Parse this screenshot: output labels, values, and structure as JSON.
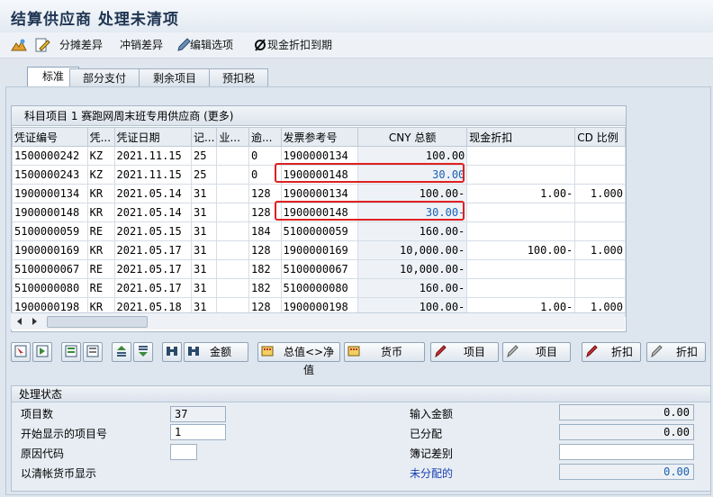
{
  "window": {
    "title": "结算供应商 处理未清项"
  },
  "toolbar": {
    "items": [
      {
        "label": "分摊差异"
      },
      {
        "label": "冲销差异"
      },
      {
        "label": "编辑选项"
      },
      {
        "label": "现金折扣到期"
      }
    ]
  },
  "tabs": [
    {
      "label": "标准"
    },
    {
      "label": "部分支付"
    },
    {
      "label": "剩余项目"
    },
    {
      "label": "预扣税"
    }
  ],
  "table": {
    "title": "科目项目 1 赛跑网周末班专用供应商 (更多)",
    "columns": [
      "凭证编号",
      "凭...",
      "凭证日期",
      "记...",
      "业...",
      "逾...",
      "发票参考号",
      "CNY 总额",
      "现金折扣",
      "CD 比例"
    ],
    "rows": [
      [
        "1500000242",
        "KZ",
        "2021.11.15",
        "25",
        "",
        "0",
        "1900000134",
        "100.00",
        "",
        ""
      ],
      [
        "1500000243",
        "KZ",
        "2021.11.15",
        "25",
        "",
        "0",
        "1900000148",
        "30.00",
        "",
        ""
      ],
      [
        "1900000134",
        "KR",
        "2021.05.14",
        "31",
        "",
        "128",
        "1900000134",
        "100.00-",
        "1.00-",
        "1.000"
      ],
      [
        "1900000148",
        "KR",
        "2021.05.14",
        "31",
        "",
        "128",
        "1900000148",
        "30.00-",
        "",
        ""
      ],
      [
        "5100000059",
        "RE",
        "2021.05.15",
        "31",
        "",
        "184",
        "5100000059",
        "160.00-",
        "",
        ""
      ],
      [
        "1900000169",
        "KR",
        "2021.05.17",
        "31",
        "",
        "128",
        "1900000169",
        "10,000.00-",
        "100.00-",
        "1.000"
      ],
      [
        "5100000067",
        "RE",
        "2021.05.17",
        "31",
        "",
        "182",
        "5100000067",
        "10,000.00-",
        "",
        ""
      ],
      [
        "5100000080",
        "RE",
        "2021.05.17",
        "31",
        "",
        "182",
        "5100000080",
        "160.00-",
        "",
        ""
      ],
      [
        "1900000198",
        "KR",
        "2021.05.18",
        "31",
        "",
        "128",
        "1900000198",
        "100.00-",
        "1.00-",
        "1.000"
      ]
    ],
    "highlight_color": "#e02020",
    "amount_blue": "#1a5fb4"
  },
  "buttons": {
    "amount": "金额",
    "gross_net": "总值<>净值",
    "currency": "货币",
    "item1": "项目",
    "item2": "项目",
    "discount1": "折扣",
    "discount2": "折扣"
  },
  "status": {
    "title": "处理状态",
    "item_count_label": "项目数",
    "item_count": "37",
    "first_item_label": "开始显示的项目号",
    "first_item": "1",
    "reason_label": "原因代码",
    "reason": "",
    "clearing_currency_label": "以清帐货币显示",
    "entered_amount_label": "输入金额",
    "entered_amount": "0.00",
    "assigned_label": "已分配",
    "assigned": "0.00",
    "diff_label": "簿记差别",
    "diff": "",
    "unassigned_label": "未分配的",
    "unassigned": "0.00"
  }
}
